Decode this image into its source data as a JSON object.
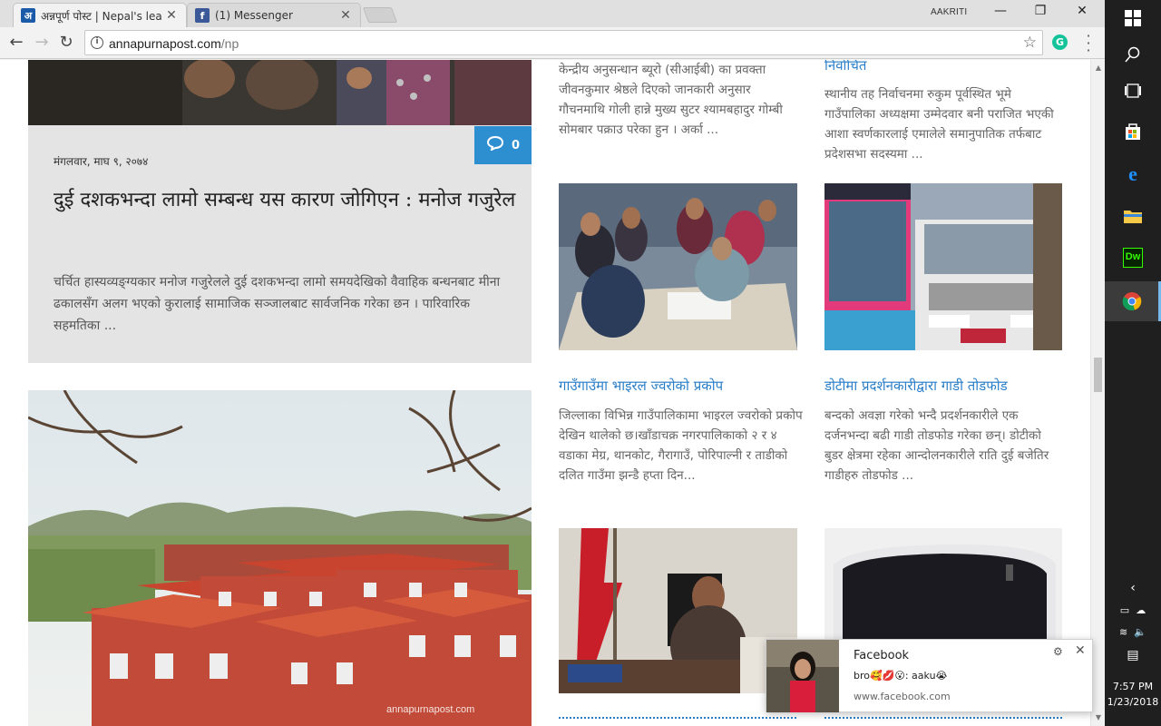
{
  "browser": {
    "tabs": [
      {
        "title": "अन्नपूर्ण पोस्ट | Nepal's lea",
        "favicon": "annapurna-post-icon",
        "active": true
      },
      {
        "title": "(1) Messenger",
        "favicon": "facebook-icon",
        "active": false
      }
    ],
    "profile_name": "AAKRITI",
    "address": {
      "host": "annapurnapost.com",
      "path": "/np"
    },
    "extension": "G"
  },
  "featured": {
    "comment_count": "0",
    "date": "मंगलवार, माघ ९, २०७४",
    "title": "दुई दशकभन्दा लामो सम्बन्ध यस कारण जोगिएन : मनोज गजुरेल",
    "excerpt": "चर्चित हास्यव्यङ्ग्यकार मनोज गजुरेलले दुई दशकभन्दा लामो समयदेखिको वैवाहिक बन्धनबाट मीना ढकालसँग अलग भएको कुरालाई सामाजिक सञ्जालबाट सार्वजनिक गरेका छन । पारिवारिक सहमतिका ..."
  },
  "grid": {
    "top_left_snippet": "केन्द्रीय अनुसन्धान ब्यूरो (सीआईबी) का प्रवक्ता जीवनकुमार श्रेष्ठले दिएको जानकारी अनुसार गौचनमाथि गोली हान्ने मुख्य सुटर श्यामबहादुर गोम्बी सोमबार पक्राउ परेका हुन । अर्का ...",
    "top_right_title_tail": "निर्वाचित",
    "top_right_snippet": "स्थानीय तह निर्वाचनमा रुकुम पूर्वस्थित भूमे गाउँपालिका अध्यक्षमा उम्मेदवार बनी पराजित भएकी आशा स्वर्णकारलाई एमालेले समानुपातिक तर्फबाट प्रदेशसभा सदस्यमा ...",
    "articles": [
      {
        "title": "गाउँगाउँमा भाइरल ज्वरोको प्रकोप",
        "excerpt": " जिल्लाका विभिन्न गाउँपालिकामा भाइरल ज्वरोको प्रकोप देखिन थालेको छ।खाँडाचक्र नगरपालिकाको २ र ४ वडाका मेग्र, थानकोट, गैरागाउँ, पोरिपाल्नी र ताडीको दलित गाउँमा झन्डै हप्ता दिन..."
      },
      {
        "title": "डोटीमा प्रदर्शनकारीद्वारा गाडी तोडफोड",
        "excerpt": "बन्दको अवज्ञा गरेको भन्दै प्रदर्शनकारीले एक दर्जनभन्दा बढी गाडी तोडफोड गरेका छन्। डोटीको बुडर क्षेत्रमा रहेका आन्दोलनकारीले राति दुई बजेतिर गाडीहरु तोडफोड ..."
      }
    ],
    "watermark": "annapurnapost.com"
  },
  "notification": {
    "title": "Facebook",
    "body": "bro🥰💋😮: aaku😭",
    "site": "www.facebook.com"
  },
  "taskbar": {
    "apps": [
      "windows-start",
      "search",
      "task-view",
      "store",
      "edge",
      "file-explorer",
      "dreamweaver",
      "chrome"
    ],
    "dreamweaver_label": "Dw",
    "time": "7:57 PM",
    "date": "1/23/2018"
  }
}
